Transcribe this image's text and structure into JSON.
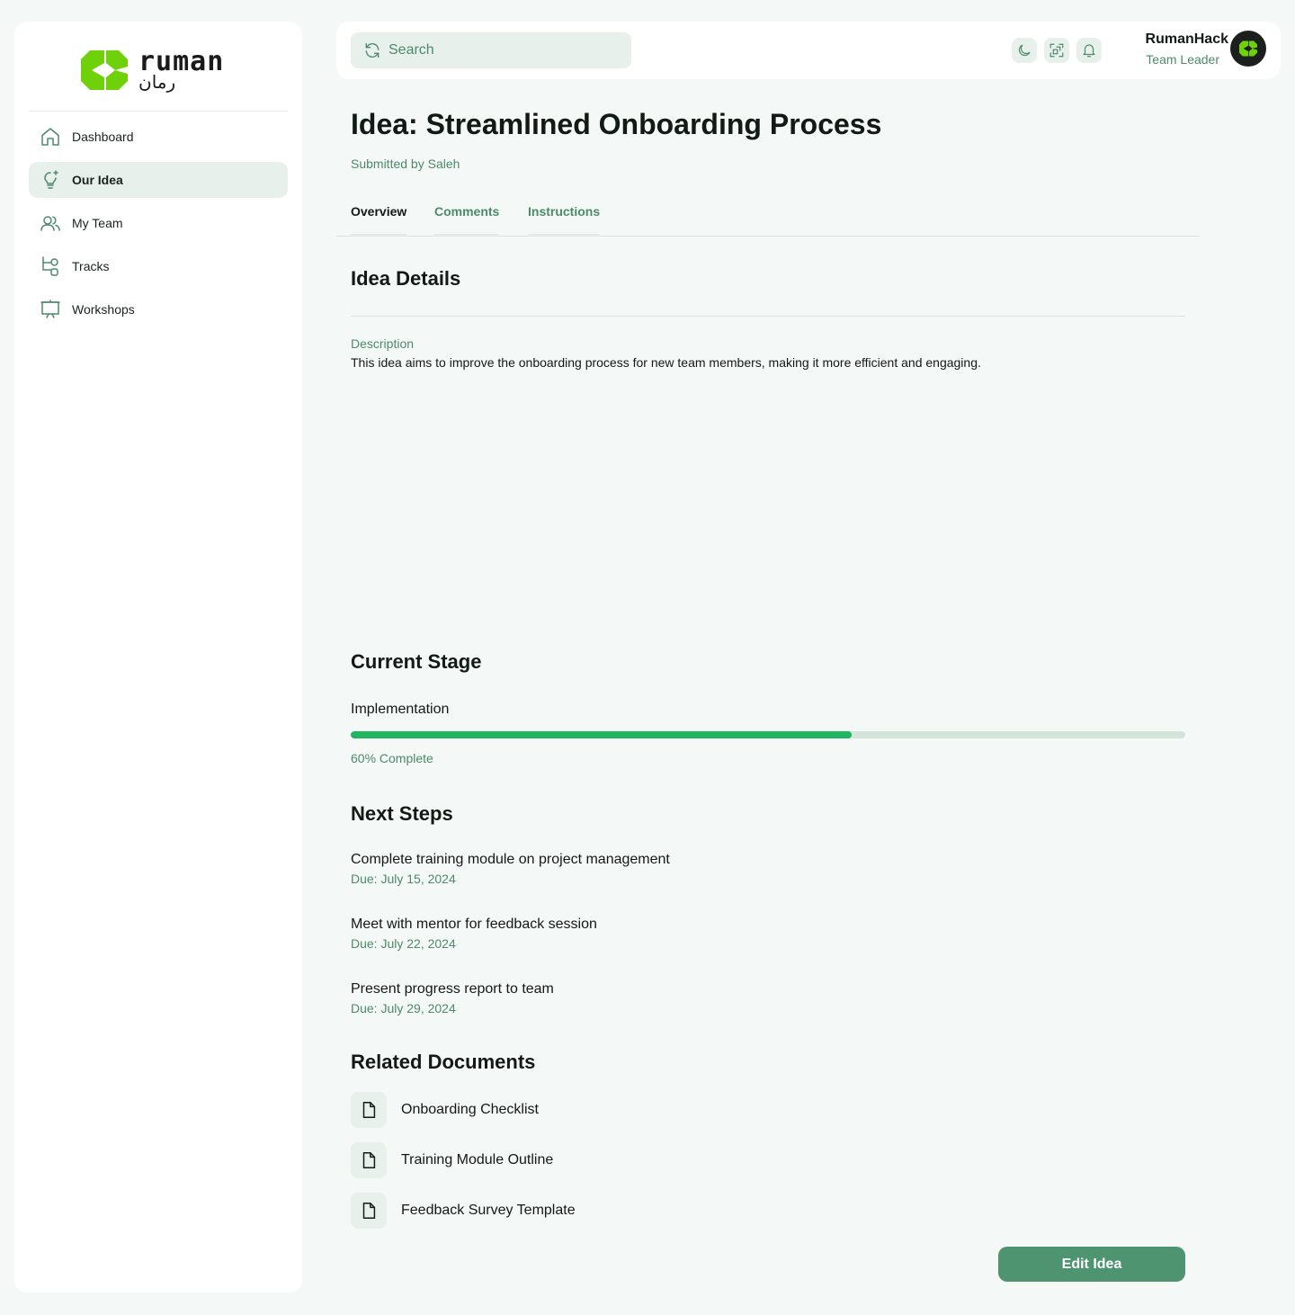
{
  "brand": {
    "logo_latin": "ruman",
    "logo_arabic": "رمان",
    "accent_green": "#6fd10a",
    "primary": "#4f9470",
    "muted_text": "#4d8a6a"
  },
  "sidebar": {
    "items": [
      {
        "label": "Dashboard",
        "icon": "home-icon",
        "active": false
      },
      {
        "label": "Our Idea",
        "icon": "lightbulb-icon",
        "active": true
      },
      {
        "label": "My Team",
        "icon": "users-icon",
        "active": false
      },
      {
        "label": "Tracks",
        "icon": "tracks-icon",
        "active": false
      },
      {
        "label": "Workshops",
        "icon": "presentation-icon",
        "active": false
      }
    ]
  },
  "topbar": {
    "search_placeholder": "Search",
    "icons": [
      "moon-icon",
      "scan-icon",
      "bell-icon"
    ],
    "user_name": "RumanHack",
    "user_role": "Team Leader"
  },
  "idea": {
    "title": "Idea: Streamlined Onboarding Process",
    "submitted_by": "Submitted by Saleh"
  },
  "tabs": [
    {
      "label": "Overview",
      "active": true
    },
    {
      "label": "Comments",
      "active": false
    },
    {
      "label": "Instructions",
      "active": false
    }
  ],
  "details": {
    "heading": "Idea Details",
    "description_label": "Description",
    "description": "This idea aims to improve the onboarding process for new team members, making it more efficient and engaging."
  },
  "stage": {
    "heading": "Current Stage",
    "name": "Implementation",
    "progress_percent": 60,
    "progress_text": "60% Complete",
    "progress_color": "#1fb561",
    "track_color": "#d3e5db"
  },
  "next_steps": {
    "heading": "Next Steps",
    "items": [
      {
        "title": "Complete training module on project management",
        "due": "Due: July 15, 2024"
      },
      {
        "title": "Meet with mentor for feedback session",
        "due": "Due: July 22, 2024"
      },
      {
        "title": "Present progress report to team",
        "due": "Due: July 29, 2024"
      }
    ]
  },
  "documents": {
    "heading": "Related Documents",
    "items": [
      {
        "name": "Onboarding Checklist",
        "icon": "document-icon"
      },
      {
        "name": "Training Module Outline",
        "icon": "document-icon"
      },
      {
        "name": "Feedback Survey Template",
        "icon": "document-icon"
      }
    ]
  },
  "actions": {
    "edit_label": "Edit Idea"
  }
}
